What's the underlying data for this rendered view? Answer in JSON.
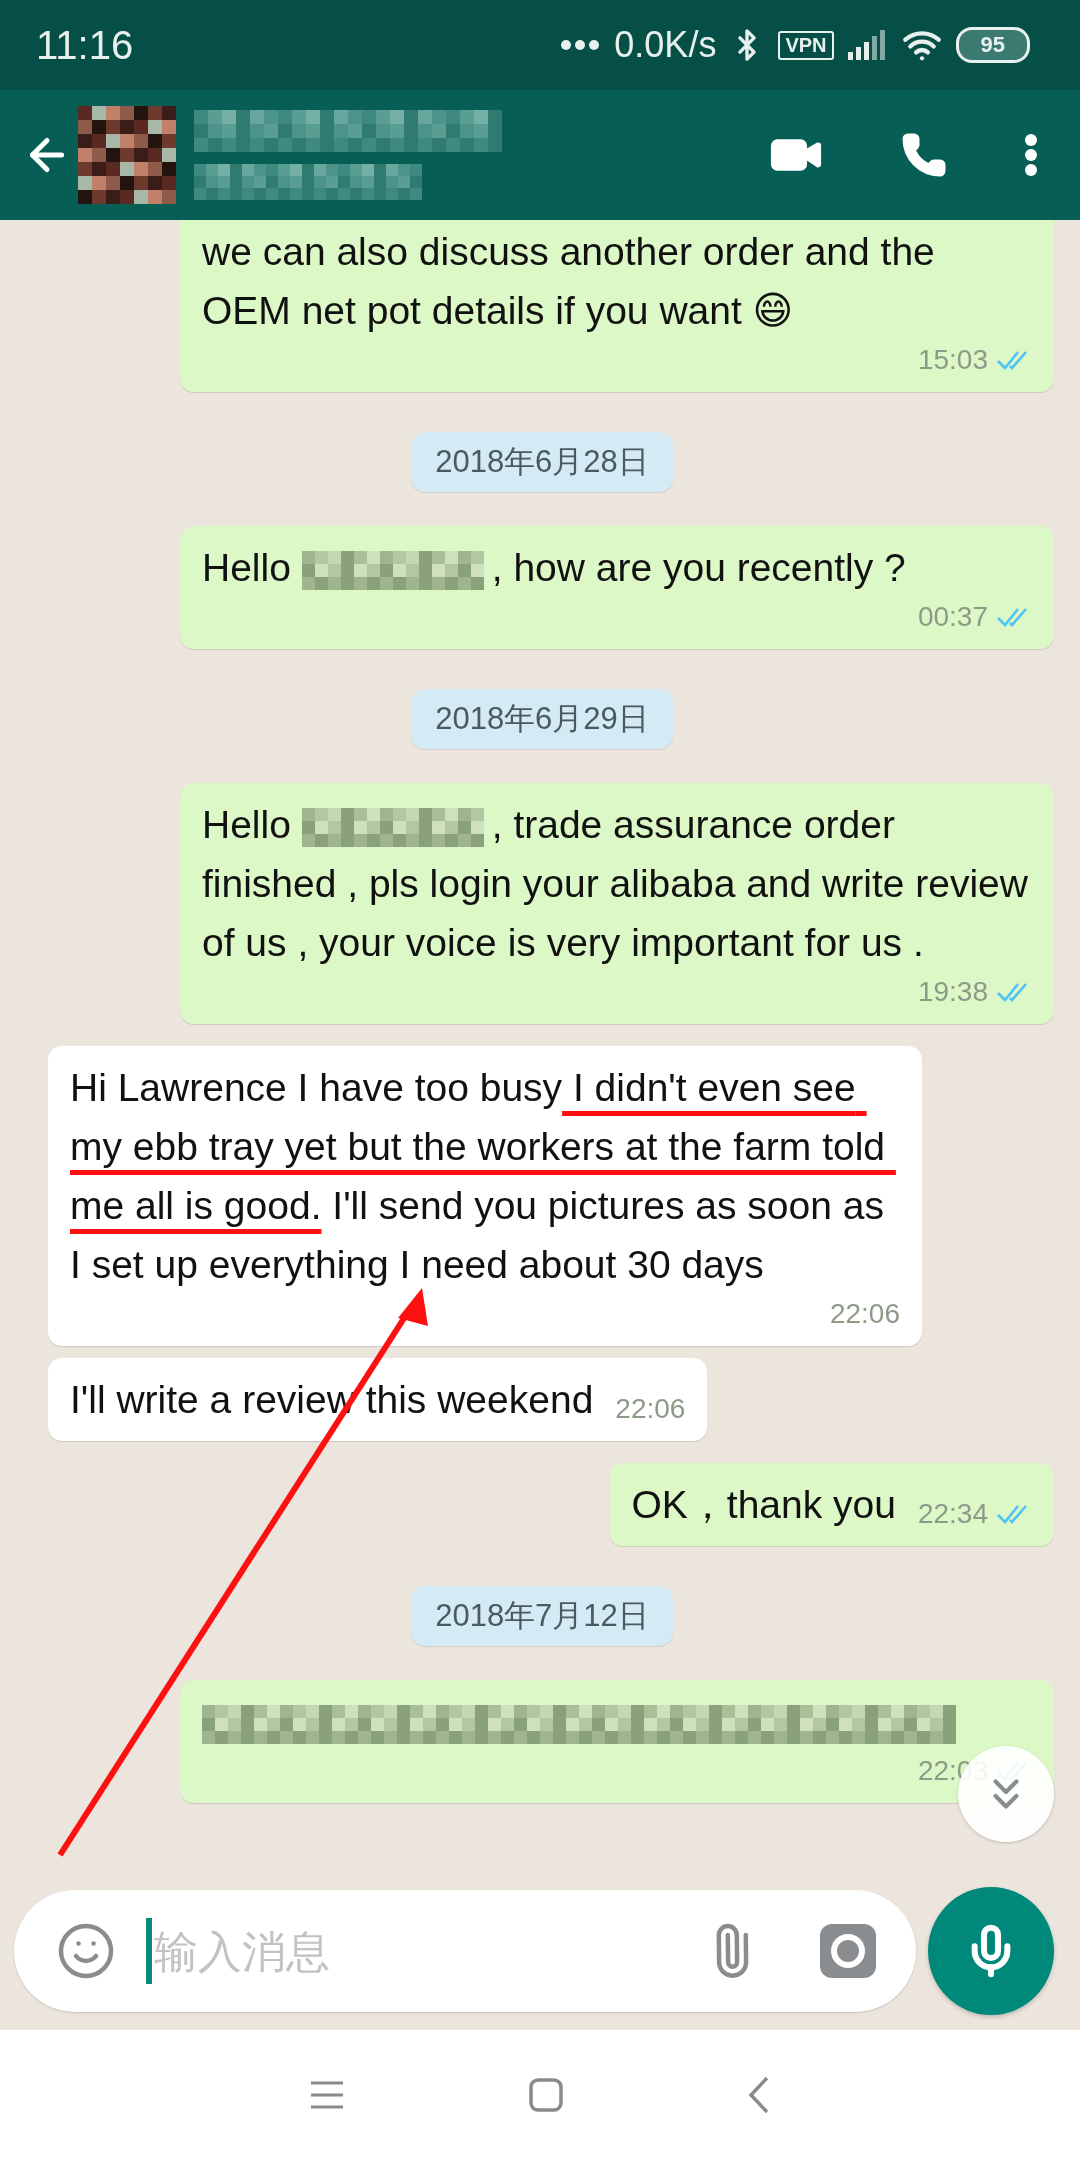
{
  "status_bar": {
    "time": "11:16",
    "speed": "0.0K/s",
    "vpn": "VPN",
    "battery": "95"
  },
  "chat": {
    "messages": [
      {
        "kind": "message",
        "outgoing": true,
        "time": "15:03",
        "read": true,
        "segments": [
          {
            "kind": "text",
            "text": "we can also discuss another order and the OEM net pot details if you want 😄"
          }
        ]
      },
      {
        "kind": "date",
        "text": "2018年6月28日"
      },
      {
        "kind": "message",
        "outgoing": true,
        "time": "00:37",
        "read": true,
        "segments": [
          {
            "kind": "text",
            "text": "Hello"
          },
          {
            "kind": "redacted"
          },
          {
            "kind": "text",
            "text": ", how are you recently ?"
          }
        ]
      },
      {
        "kind": "date",
        "text": "2018年6月29日"
      },
      {
        "kind": "message",
        "outgoing": true,
        "time": "19:38",
        "read": true,
        "segments": [
          {
            "kind": "text",
            "text": "Hello"
          },
          {
            "kind": "redacted"
          },
          {
            "kind": "text",
            "text": ", trade assurance order finished , pls login your alibaba and write review of us , your voice is very important for us ."
          }
        ]
      },
      {
        "kind": "message",
        "outgoing": false,
        "time": "22:06",
        "segments": [
          {
            "kind": "text",
            "text": "Hi Lawrence I have too busy"
          },
          {
            "kind": "underlined",
            "text": " I didn't even see my ebb tray yet but the workers at the farm told me all is good."
          },
          {
            "kind": "text",
            "text": " I'll send you pictures as soon as I set up everything I need about 30 days"
          }
        ]
      },
      {
        "kind": "message",
        "outgoing": false,
        "time": "22:06",
        "segments": [
          {
            "kind": "text",
            "text": "I'll write a review this weekend"
          }
        ]
      },
      {
        "kind": "message",
        "outgoing": true,
        "time": "22:34",
        "read": true,
        "segments": [
          {
            "kind": "text",
            "text": "OK，thank you"
          }
        ]
      },
      {
        "kind": "date",
        "text": "2018年7月12日"
      },
      {
        "kind": "message",
        "outgoing": true,
        "time": "22:03",
        "read": true,
        "segments": [
          {
            "kind": "redacted"
          }
        ]
      }
    ]
  },
  "input": {
    "placeholder": "输入消息"
  }
}
